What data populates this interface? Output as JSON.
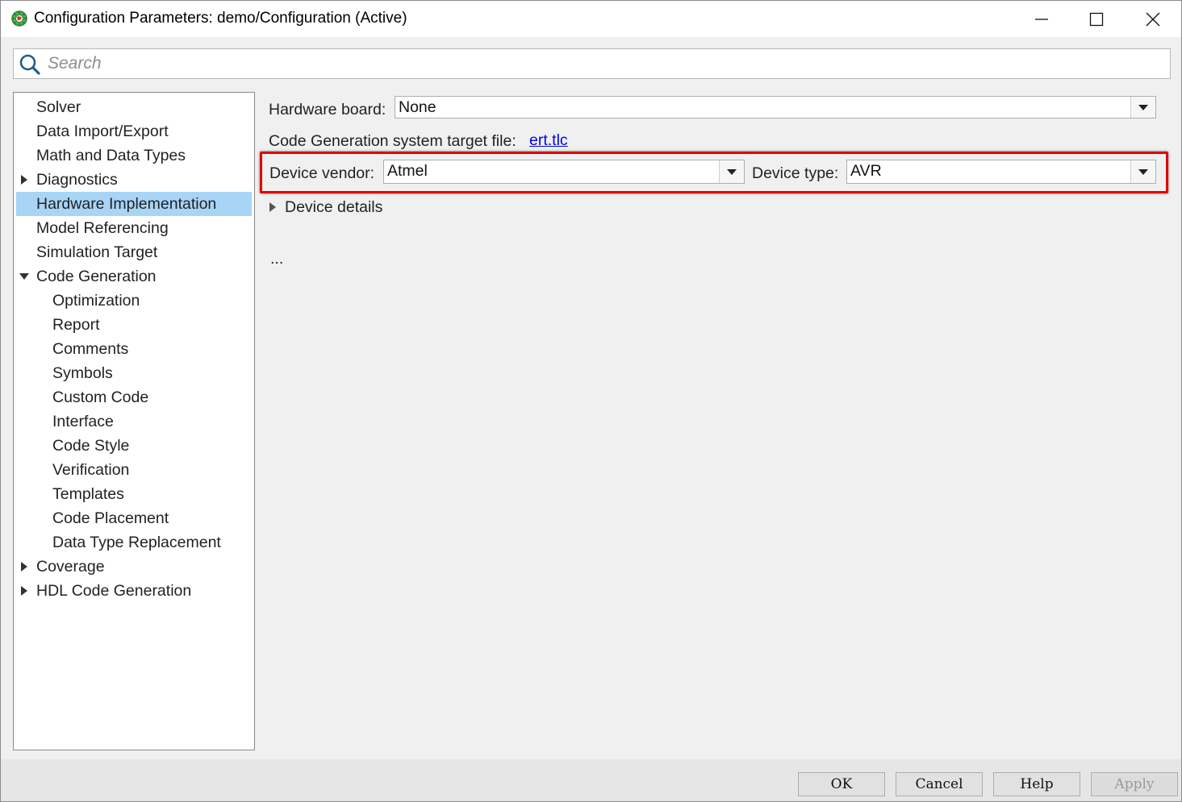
{
  "window": {
    "title": "Configuration Parameters: demo/Configuration (Active)",
    "icons": {
      "app": "matlab-gear-icon",
      "minimize": "minimize-icon",
      "maximize": "maximize-icon",
      "close": "close-icon"
    }
  },
  "search": {
    "placeholder": "Search",
    "value": "",
    "icon": "search-icon"
  },
  "tree": {
    "items": [
      {
        "label": "Solver",
        "level": 0,
        "toggle": "none",
        "selected": false
      },
      {
        "label": "Data Import/Export",
        "level": 0,
        "toggle": "none",
        "selected": false
      },
      {
        "label": "Math and Data Types",
        "level": 0,
        "toggle": "none",
        "selected": false
      },
      {
        "label": "Diagnostics",
        "level": 0,
        "toggle": "collapsed",
        "selected": false
      },
      {
        "label": "Hardware Implementation",
        "level": 0,
        "toggle": "none",
        "selected": true
      },
      {
        "label": "Model Referencing",
        "level": 0,
        "toggle": "none",
        "selected": false
      },
      {
        "label": "Simulation Target",
        "level": 0,
        "toggle": "none",
        "selected": false
      },
      {
        "label": "Code Generation",
        "level": 0,
        "toggle": "expanded",
        "selected": false
      },
      {
        "label": "Optimization",
        "level": 1,
        "toggle": "none",
        "selected": false
      },
      {
        "label": "Report",
        "level": 1,
        "toggle": "none",
        "selected": false
      },
      {
        "label": "Comments",
        "level": 1,
        "toggle": "none",
        "selected": false
      },
      {
        "label": "Symbols",
        "level": 1,
        "toggle": "none",
        "selected": false
      },
      {
        "label": "Custom Code",
        "level": 1,
        "toggle": "none",
        "selected": false
      },
      {
        "label": "Interface",
        "level": 1,
        "toggle": "none",
        "selected": false
      },
      {
        "label": "Code Style",
        "level": 1,
        "toggle": "none",
        "selected": false
      },
      {
        "label": "Verification",
        "level": 1,
        "toggle": "none",
        "selected": false
      },
      {
        "label": "Templates",
        "level": 1,
        "toggle": "none",
        "selected": false
      },
      {
        "label": "Code Placement",
        "level": 1,
        "toggle": "none",
        "selected": false
      },
      {
        "label": "Data Type Replacement",
        "level": 1,
        "toggle": "none",
        "selected": false
      },
      {
        "label": "Coverage",
        "level": 0,
        "toggle": "collapsed",
        "selected": false
      },
      {
        "label": "HDL Code Generation",
        "level": 0,
        "toggle": "collapsed",
        "selected": false
      }
    ]
  },
  "main": {
    "hardware_board_label": "Hardware board:",
    "hardware_board_value": "None",
    "target_file_label": "Code Generation system target file:",
    "target_file_link": "ert.tlc",
    "device_vendor_label": "Device vendor:",
    "device_vendor_value": "Atmel",
    "device_type_label": "Device type:",
    "device_type_value": "AVR",
    "device_details_label": "Device details",
    "ellipsis": "...",
    "highlight_color": "#e00000",
    "selection_color": "#a8d4f5"
  },
  "buttons": {
    "ok": "OK",
    "cancel": "Cancel",
    "help": "Help",
    "apply": "Apply",
    "apply_enabled": false
  }
}
